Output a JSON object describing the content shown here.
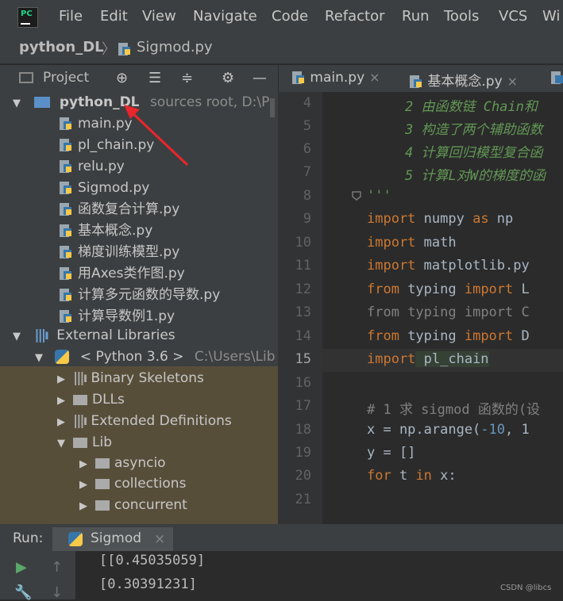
{
  "app": {
    "logo_text": "PC",
    "menu": [
      "File",
      "Edit",
      "View",
      "Navigate",
      "Code",
      "Refactor",
      "Run",
      "Tools",
      "VCS",
      "Wi"
    ]
  },
  "breadcrumb": {
    "project": "python_DL",
    "separator": "〉",
    "file": "Sigmod.py"
  },
  "project_tool": {
    "label": "Project",
    "icons": [
      "target-icon",
      "collapse-icon",
      "expand-icon",
      "gear-icon",
      "minimize-icon"
    ]
  },
  "tree": {
    "root": {
      "name": "python_DL",
      "hint": "sources root,  D:\\P"
    },
    "files": [
      "main.py",
      "pl_chain.py",
      "relu.py",
      "Sigmod.py",
      "函数复合计算.py",
      "基本概念.py",
      "梯度训练模型.py",
      "用Axes类作图.py",
      "计算多元函数的导数.py",
      "计算导数例1.py"
    ],
    "external": "External Libraries",
    "python": {
      "name": "< Python 3.6 >",
      "path": "C:\\Users\\Lib"
    },
    "lib_items": [
      "Binary Skeletons",
      "DLLs",
      "Extended Definitions",
      "Lib"
    ],
    "lib_children": [
      "asyncio",
      "collections",
      "concurrent"
    ]
  },
  "tabs": [
    {
      "label": "main.py",
      "close": "×"
    },
    {
      "label": "基本概念.py",
      "close": "×"
    }
  ],
  "editor": {
    "lines": [
      {
        "n": "4",
        "text": "2 由函数链 Chain和"
      },
      {
        "n": "5",
        "text": "3 构造了两个辅助函数"
      },
      {
        "n": "6",
        "text": "4 计算回归模型复合函"
      },
      {
        "n": "7",
        "text": "5 计算L对W的梯度的函"
      },
      {
        "n": "8",
        "text": "'''"
      },
      {
        "n": "9",
        "kw": "import",
        "rest": " numpy ",
        "kw2": "as",
        "rest2": " np"
      },
      {
        "n": "10",
        "kw": "import",
        "rest": " math"
      },
      {
        "n": "11",
        "kw": "import",
        "rest": " matplotlib.py"
      },
      {
        "n": "12",
        "kw": "from",
        "rest": " typing ",
        "kw2": "import",
        "rest2": " L"
      },
      {
        "n": "13",
        "kw": "from",
        "rest": " typing ",
        "kw2": "import",
        "rest2": " C"
      },
      {
        "n": "14",
        "kw": "from",
        "rest": " typing ",
        "kw2": "import",
        "rest2": " D"
      },
      {
        "n": "15",
        "kw": "import",
        "rest": " pl_chain"
      },
      {
        "n": "16",
        "text": ""
      },
      {
        "n": "17",
        "text": "# 1 求 sigmod 函数的(设"
      },
      {
        "n": "18",
        "pre": "x = np.arange(",
        "num": "-10",
        "post": ", 1"
      },
      {
        "n": "19",
        "text": "y = []"
      },
      {
        "n": "20",
        "kw": "for",
        "rest": " t ",
        "kw2": "in",
        "rest2": " x:"
      },
      {
        "n": "21",
        "text": ""
      }
    ]
  },
  "run": {
    "label": "Run:",
    "tab": "Sigmod",
    "close": "×",
    "output": [
      "[[0.45035059]",
      "[0.30391231]"
    ]
  },
  "watermark": "CSDN @libcs"
}
